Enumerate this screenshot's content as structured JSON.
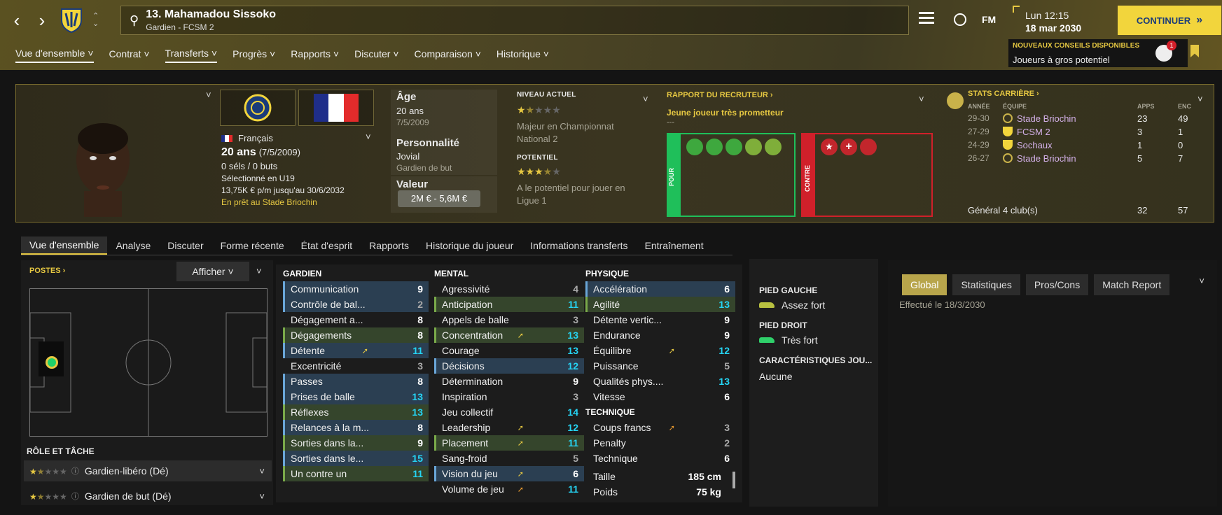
{
  "header": {
    "player_name": "13. Mahamadou Sissoko",
    "player_sub": "Gardien - FCSM 2",
    "time": "Lun 12:15",
    "date": "18 mar 2030",
    "continue_label": "CONTINUER",
    "fm_label": "FM",
    "advice_title": "NOUVEAUX CONSEILS DISPONIBLES",
    "advice_text": "Joueurs à gros potentiel",
    "advice_count": "1"
  },
  "nav": [
    "Vue d'ensemble",
    "Contrat",
    "Transferts",
    "Progrès",
    "Rapports",
    "Discuter",
    "Comparaison",
    "Historique"
  ],
  "card": {
    "nationality": "Français",
    "age_line": "20 ans",
    "age_birth": "(7/5/2009)",
    "caps": "0 séls / 0 buts",
    "selected": "Sélectionné en U19",
    "wage": "13,75K € p/m jusqu'au 30/6/2032",
    "loan": "En prêt au Stade Briochin",
    "age_label": "Âge",
    "age_value": "20 ans",
    "dob": "7/5/2009",
    "personality_label": "Personnalité",
    "personality_value": "Jovial",
    "role_text": "Gardien de but",
    "value_label": "Valeur",
    "value_text": "2M € - 5,6M €",
    "current_level_label": "NIVEAU ACTUEL",
    "current_level_stars": 1.5,
    "current_level_text": "Majeur en Championnat National 2",
    "potential_label": "POTENTIEL",
    "potential_stars": 3.5,
    "potential_text": "A le potentiel pour jouer en Ligue 1",
    "scout_title": "RAPPORT DU RECRUTEUR",
    "scout_headline": "Jeune joueur très prometteur",
    "scout_dash": "---",
    "pour_label": "POUR",
    "contre_label": "CONTRE",
    "career_title": "STATS CARRIÈRE",
    "career_cols": [
      "ANNÉE",
      "ÉQUIPE",
      "APPS",
      "ENC"
    ],
    "career_rows": [
      {
        "year": "29-30",
        "team": "Stade Briochin",
        "apps": "23",
        "enc": "49"
      },
      {
        "year": "27-29",
        "team": "FCSM 2",
        "apps": "3",
        "enc": "1"
      },
      {
        "year": "24-29",
        "team": "Sochaux",
        "apps": "1",
        "enc": "0"
      },
      {
        "year": "26-27",
        "team": "Stade Briochin",
        "apps": "5",
        "enc": "7"
      }
    ],
    "career_total_label": "Général",
    "career_total_clubs": "4 club(s)",
    "career_total_apps": "32",
    "career_total_enc": "57"
  },
  "tabs": [
    "Vue d'ensemble",
    "Analyse",
    "Discuter",
    "Forme récente",
    "État d'esprit",
    "Rapports",
    "Historique du joueur",
    "Informations transferts",
    "Entraînement"
  ],
  "positions": {
    "title": "POSTES",
    "show_label": "Afficher",
    "role_title": "RÔLE ET TÂCHE",
    "roles": [
      {
        "name": "Gardien-libéro (Dé)",
        "stars": 1.5
      },
      {
        "name": "Gardien de but (Dé)",
        "stars": 1.5
      }
    ]
  },
  "attributes": {
    "gardien_title": "GARDIEN",
    "gardien": [
      {
        "n": "Communication",
        "v": "9"
      },
      {
        "n": "Contrôle de bal...",
        "v": "2"
      },
      {
        "n": "Dégagement a...",
        "v": "8"
      },
      {
        "n": "Dégagements",
        "v": "8"
      },
      {
        "n": "Détente",
        "v": "11"
      },
      {
        "n": "Excentricité",
        "v": "3"
      },
      {
        "n": "Passes",
        "v": "8"
      },
      {
        "n": "Prises de balle",
        "v": "13"
      },
      {
        "n": "Réflexes",
        "v": "13"
      },
      {
        "n": "Relances à la m...",
        "v": "8"
      },
      {
        "n": "Sorties dans la...",
        "v": "9"
      },
      {
        "n": "Sorties dans le...",
        "v": "15"
      },
      {
        "n": "Un contre un",
        "v": "11"
      }
    ],
    "mental_title": "MENTAL",
    "mental": [
      {
        "n": "Agressivité",
        "v": "4"
      },
      {
        "n": "Anticipation",
        "v": "11"
      },
      {
        "n": "Appels de balle",
        "v": "3"
      },
      {
        "n": "Concentration",
        "v": "13"
      },
      {
        "n": "Courage",
        "v": "13"
      },
      {
        "n": "Décisions",
        "v": "12"
      },
      {
        "n": "Détermination",
        "v": "9"
      },
      {
        "n": "Inspiration",
        "v": "3"
      },
      {
        "n": "Jeu collectif",
        "v": "14"
      },
      {
        "n": "Leadership",
        "v": "12"
      },
      {
        "n": "Placement",
        "v": "11"
      },
      {
        "n": "Sang-froid",
        "v": "5"
      },
      {
        "n": "Vision du jeu",
        "v": "6"
      },
      {
        "n": "Volume de jeu",
        "v": "11"
      }
    ],
    "physique_title": "PHYSIQUE",
    "physique": [
      {
        "n": "Accélération",
        "v": "6"
      },
      {
        "n": "Agilité",
        "v": "13"
      },
      {
        "n": "Détente vertic...",
        "v": "9"
      },
      {
        "n": "Endurance",
        "v": "9"
      },
      {
        "n": "Équilibre",
        "v": "12"
      },
      {
        "n": "Puissance",
        "v": "5"
      },
      {
        "n": "Qualités phys....",
        "v": "13"
      },
      {
        "n": "Vitesse",
        "v": "6"
      }
    ],
    "technique_title": "TECHNIQUE",
    "technique": [
      {
        "n": "Coups francs",
        "v": "3"
      },
      {
        "n": "Penalty",
        "v": "2"
      },
      {
        "n": "Technique",
        "v": "6"
      }
    ],
    "height_label": "Taille",
    "height_value": "185 cm",
    "weight_label": "Poids",
    "weight_value": "75 kg"
  },
  "feet": {
    "left_label": "PIED GAUCHE",
    "left_value": "Assez fort",
    "right_label": "PIED DROIT",
    "right_value": "Très fort",
    "traits_label": "CARACTÉRISTIQUES JOU...",
    "traits_value": "Aucune"
  },
  "report": {
    "tabs": [
      "Global",
      "Statistiques",
      "Pros/Cons",
      "Match Report"
    ],
    "date_text": "Effectué le 18/3/2030"
  },
  "colors": {
    "accent": "#e6c842",
    "cyan": "#25d5f5",
    "pour": "#1fbf5a",
    "contre": "#d0202a"
  }
}
